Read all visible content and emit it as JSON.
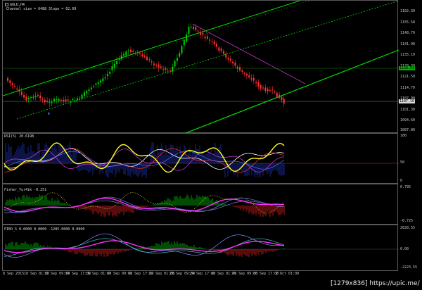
{
  "main": {
    "symbol": "GOLD,H4",
    "channel_info": "Channel size = 6488 Slope = 62.69",
    "price_labels": [
      "1162.30",
      "1155.50",
      "1148.70",
      "1141.90",
      "1135.10",
      "1128.30",
      "1121.50",
      "1114.70",
      "1107.90",
      "1101.30",
      "1094.60",
      "1087.80"
    ],
    "current_price": "1107.10",
    "level_tag": "1128.53",
    "colors": {
      "up": "#00d000",
      "down": "#ff3232",
      "channel": "#00e000",
      "slope": "#c030c0"
    }
  },
  "rsi": {
    "label": "RSI(5) 20.6198",
    "levels": [
      "100",
      "50",
      "0"
    ]
  },
  "fisher": {
    "label": "Fisher_Yur4ik -0.251",
    "levels": [
      "0.795",
      "-0.725"
    ]
  },
  "fibo": {
    "label": "FIBO_S 0.0000 0.0000 -1285.0000 0.0000",
    "levels": [
      "2628.55",
      "0.00",
      "-2223.55"
    ]
  },
  "time_axis": [
    "8 Sep 2015",
    "10 Sep 01:00",
    "11 Sep 09:00",
    "14 Sep 17:00",
    "16 Sep 01:00",
    "17 Sep 09:00",
    "18 Sep 17:00",
    "22 Sep 01:00",
    "23 Sep 09:00",
    "24 Sep 17:00",
    "28 Sep 01:00",
    "29 Sep 09:00",
    "30 Sep 17:00",
    "2 Oct 01:00"
  ],
  "watermark": "[1279x836] https://upic.me/"
}
